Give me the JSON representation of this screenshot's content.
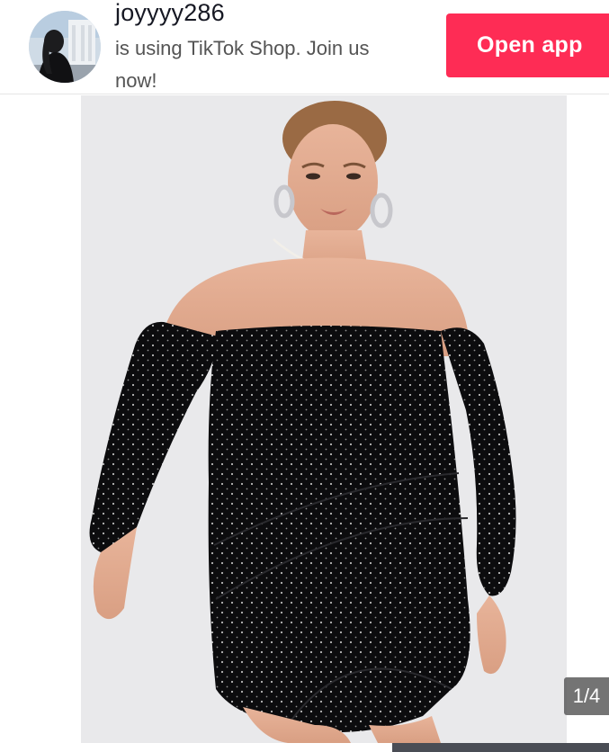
{
  "banner": {
    "username": "joyyyy286",
    "promo_line1": "is using TikTok Shop. Join us",
    "promo_line2": "now!",
    "open_app_label": "Open app"
  },
  "gallery": {
    "counter": "1/4",
    "current_index": 1,
    "total": 4
  },
  "colors": {
    "accent": "#fe2c55",
    "text_primary": "#161823",
    "text_secondary": "#545454",
    "counter_bg": "#555555",
    "image_bg": "#e9e9eb"
  },
  "icons": {
    "avatar": "user-avatar-photo",
    "product": "product-photo-black-off-shoulder-dress"
  }
}
